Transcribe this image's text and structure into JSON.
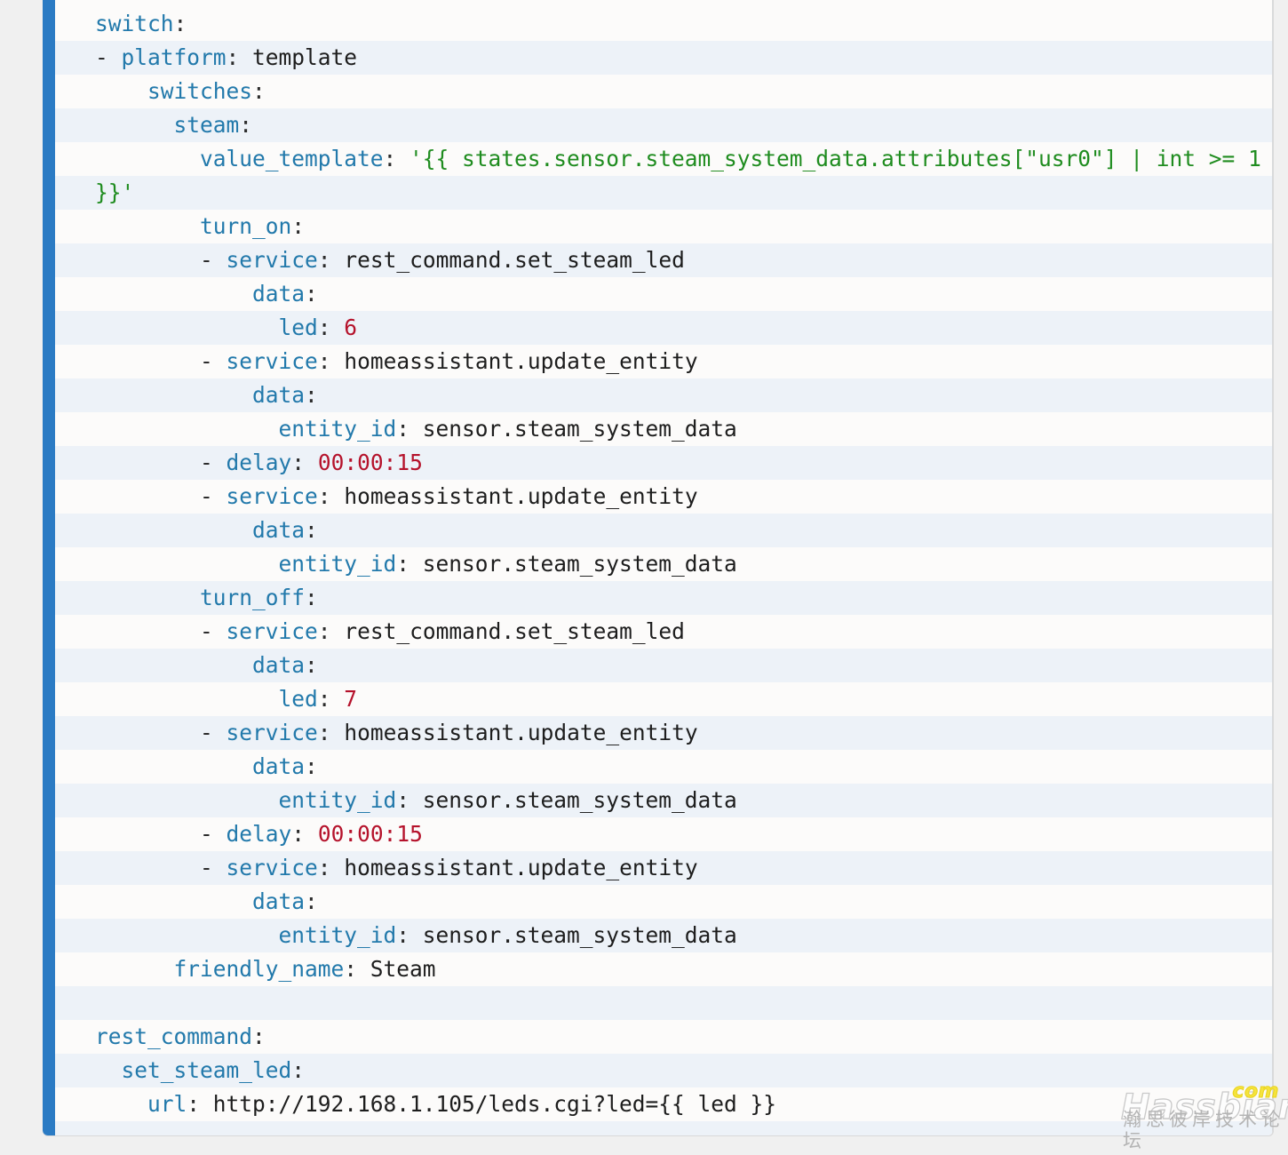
{
  "container": {
    "accent_bar_color": "#2b7bc4",
    "stripe_color_a": "#edf2f8",
    "stripe_color_b": "#fcfbfa",
    "page_background": "#f0f0f0"
  },
  "syntax_colors": {
    "key": "#2279ab",
    "value": "#1d1d1d",
    "number": "#b5122b",
    "string": "#1f8c1f",
    "punctuation": "#2b2b2b"
  },
  "code": {
    "language": "yaml",
    "lines": [
      {
        "id": "l1",
        "indent": 0,
        "key": "switch",
        "value": ""
      },
      {
        "id": "l2",
        "indent": 2,
        "dash": true,
        "key": "platform",
        "value": "template"
      },
      {
        "id": "l3",
        "indent": 4,
        "key": "switches",
        "value": ""
      },
      {
        "id": "l4",
        "indent": 6,
        "key": "steam",
        "value": ""
      },
      {
        "id": "l5",
        "indent": 8,
        "key": "value_template",
        "value": "'{{ states.sensor.steam_system_data.attributes[\"usr0\"] | int >= 1 }}'",
        "kind": "string",
        "wrapped": true
      },
      {
        "id": "l6",
        "indent": 8,
        "key": "turn_on",
        "value": ""
      },
      {
        "id": "l7",
        "indent": 10,
        "dash": true,
        "key": "service",
        "value": "rest_command.set_steam_led"
      },
      {
        "id": "l8",
        "indent": 12,
        "key": "data",
        "value": ""
      },
      {
        "id": "l9",
        "indent": 14,
        "key": "led",
        "value": "6",
        "kind": "number"
      },
      {
        "id": "l10",
        "indent": 10,
        "dash": true,
        "key": "service",
        "value": "homeassistant.update_entity"
      },
      {
        "id": "l11",
        "indent": 12,
        "key": "data",
        "value": ""
      },
      {
        "id": "l12",
        "indent": 14,
        "key": "entity_id",
        "value": "sensor.steam_system_data"
      },
      {
        "id": "l13",
        "indent": 10,
        "dash": true,
        "key": "delay",
        "value": "00:00:15",
        "kind": "number"
      },
      {
        "id": "l14",
        "indent": 10,
        "dash": true,
        "key": "service",
        "value": "homeassistant.update_entity"
      },
      {
        "id": "l15",
        "indent": 12,
        "key": "data",
        "value": ""
      },
      {
        "id": "l16",
        "indent": 14,
        "key": "entity_id",
        "value": "sensor.steam_system_data"
      },
      {
        "id": "l17",
        "indent": 8,
        "key": "turn_off",
        "value": ""
      },
      {
        "id": "l18",
        "indent": 10,
        "dash": true,
        "key": "service",
        "value": "rest_command.set_steam_led"
      },
      {
        "id": "l19",
        "indent": 12,
        "key": "data",
        "value": ""
      },
      {
        "id": "l20",
        "indent": 14,
        "key": "led",
        "value": "7",
        "kind": "number"
      },
      {
        "id": "l21",
        "indent": 10,
        "dash": true,
        "key": "service",
        "value": "homeassistant.update_entity"
      },
      {
        "id": "l22",
        "indent": 12,
        "key": "data",
        "value": ""
      },
      {
        "id": "l23",
        "indent": 14,
        "key": "entity_id",
        "value": "sensor.steam_system_data"
      },
      {
        "id": "l24",
        "indent": 10,
        "dash": true,
        "key": "delay",
        "value": "00:00:15",
        "kind": "number"
      },
      {
        "id": "l25",
        "indent": 10,
        "dash": true,
        "key": "service",
        "value": "homeassistant.update_entity"
      },
      {
        "id": "l26",
        "indent": 12,
        "key": "data",
        "value": ""
      },
      {
        "id": "l27",
        "indent": 14,
        "key": "entity_id",
        "value": "sensor.steam_system_data"
      },
      {
        "id": "l28",
        "indent": 6,
        "key": "friendly_name",
        "value": "Steam"
      },
      {
        "id": "l29",
        "blank": true
      },
      {
        "id": "l30",
        "indent": 0,
        "key": "rest_command",
        "value": ""
      },
      {
        "id": "l31",
        "indent": 2,
        "key": "set_steam_led",
        "value": ""
      },
      {
        "id": "l32",
        "indent": 4,
        "key": "url",
        "value": "http://192.168.1.105/leds.cgi?led={{ led }}"
      }
    ],
    "rendered_text": "switch:\n  - platform: template\n    switches:\n      steam:\n        value_template: '{{ states.sensor.steam_system_data.attributes[\"usr0\"] | int >= 1 }}'\n        turn_on:\n          - service: rest_command.set_steam_led\n            data:\n              led: 6\n          - service: homeassistant.update_entity\n            data:\n              entity_id: sensor.steam_system_data\n          - delay: 00:00:15\n          - service: homeassistant.update_entity\n            data:\n              entity_id: sensor.steam_system_data\n        turn_off:\n          - service: rest_command.set_steam_led\n            data:\n              led: 7\n          - service: homeassistant.update_entity\n            data:\n              entity_id: sensor.steam_system_data\n          - delay: 00:00:15\n          - service: homeassistant.update_entity\n            data:\n              entity_id: sensor.steam_system_data\n        friendly_name: Steam\n\nrest_command:\n  set_steam_led:\n    url: http://192.168.1.105/leds.cgi?led={{ led }}"
  },
  "watermark": {
    "logo_text": "Hassbian",
    "tld_text": "com",
    "subtitle_text": "瀚思彼岸技术论坛",
    "logo_color": "#fdfdfd",
    "tld_color": "#f5e33c",
    "subtitle_color": "#b4b4b4"
  }
}
